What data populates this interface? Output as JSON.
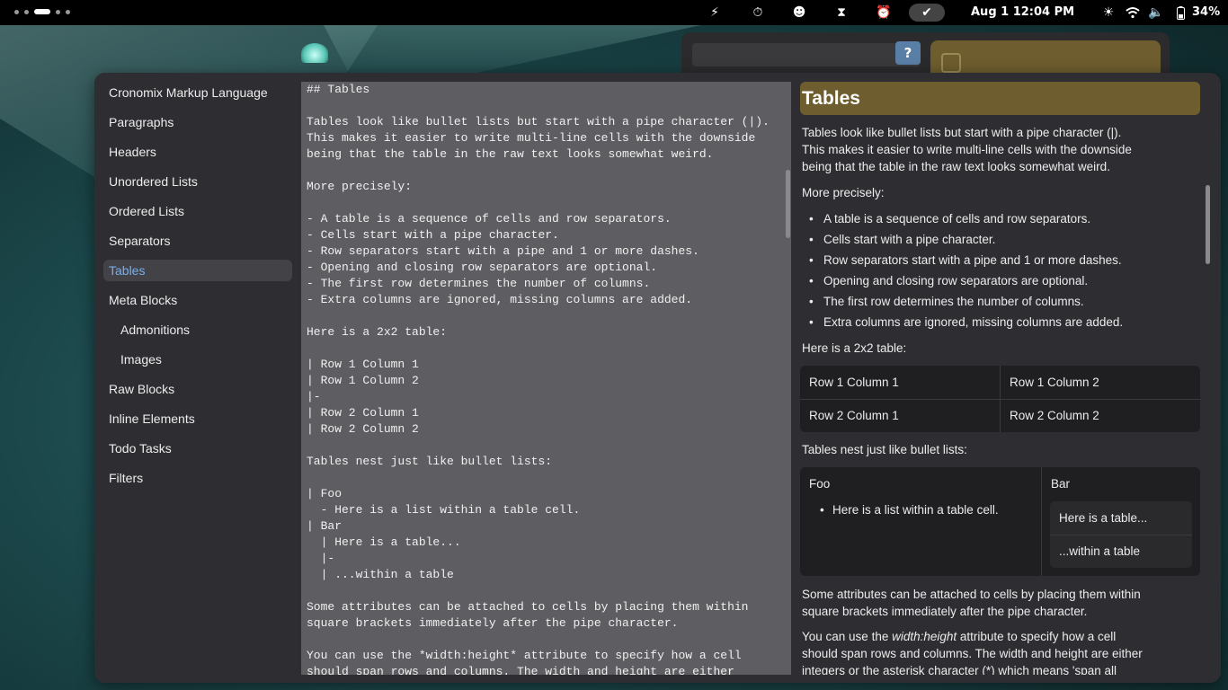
{
  "topbar": {
    "clock": "Aug 1  12:04 PM",
    "battery": "34%",
    "icons": [
      "flash-icon",
      "stopwatch-icon",
      "face-icon",
      "hourglass-icon",
      "alarm-icon",
      "check-icon",
      "brightness-icon",
      "wifi-icon",
      "volume-icon",
      "battery-icon"
    ]
  },
  "background_window": {
    "help_label": "?"
  },
  "sidebar": {
    "items": [
      {
        "label": "Cronomix Markup Language"
      },
      {
        "label": "Paragraphs"
      },
      {
        "label": "Headers"
      },
      {
        "label": "Unordered Lists"
      },
      {
        "label": "Ordered Lists"
      },
      {
        "label": "Separators"
      },
      {
        "label": "Tables"
      },
      {
        "label": "Meta Blocks"
      },
      {
        "label": "Admonitions"
      },
      {
        "label": "Images"
      },
      {
        "label": "Raw Blocks"
      },
      {
        "label": "Inline Elements"
      },
      {
        "label": "Todo Tasks"
      },
      {
        "label": "Filters"
      }
    ],
    "active": "Tables"
  },
  "editor": {
    "text": "## Tables\n\nTables look like bullet lists but start with a pipe character (|).\nThis makes it easier to write multi-line cells with the downside\nbeing that the table in the raw text looks somewhat weird.\n\nMore precisely:\n\n- A table is a sequence of cells and row separators.\n- Cells start with a pipe character.\n- Row separators start with a pipe and 1 or more dashes.\n- Opening and closing row separators are optional.\n- The first row determines the number of columns.\n- Extra columns are ignored, missing columns are added.\n\nHere is a 2x2 table:\n\n| Row 1 Column 1\n| Row 1 Column 2\n|-\n| Row 2 Column 1\n| Row 2 Column 2\n\nTables nest just like bullet lists:\n\n| Foo\n  - Here is a list within a table cell.\n| Bar\n  | Here is a table...\n  |-\n  | ...within a table\n\nSome attributes can be attached to cells by placing them within\nsquare brackets immediately after the pipe character.\n\nYou can use the *width:height* attribute to specify how a cell\nshould span rows and columns. The width and height are either"
  },
  "preview": {
    "title": "Tables",
    "intro": [
      "Tables look like bullet lists but start with a pipe character (|).",
      "This makes it easier to write multi-line cells with the downside",
      "being that the table in the raw text looks somewhat weird."
    ],
    "more_precisely": "More precisely:",
    "bullets": [
      "A table is a sequence of cells and row separators.",
      "Cells start with a pipe character.",
      "Row separators start with a pipe and 1 or more dashes.",
      "Opening and closing row separators are optional.",
      "The first row determines the number of columns.",
      "Extra columns are ignored, missing columns are added."
    ],
    "table_intro": "Here is a 2x2 table:",
    "table": [
      [
        "Row 1 Column 1",
        "Row 1 Column 2"
      ],
      [
        "Row 2 Column 1",
        "Row 2 Column 2"
      ]
    ],
    "nest_intro": "Tables nest just like bullet lists:",
    "nest": {
      "foo": "Foo",
      "foo_item": "Here is a list within a table cell.",
      "bar": "Bar",
      "bar_rows": [
        "Here is a table...",
        "...within a table"
      ]
    },
    "attr_para": [
      "Some attributes can be attached to cells by placing them within",
      "square brackets immediately after the pipe character."
    ],
    "span_para": {
      "prefix": "You can use the ",
      "em": "width:height",
      "suffix": " attribute to specify how a cell",
      "line2": "should span rows and columns. The width and height are either",
      "line3": "integers or the asterisk character (*) which means 'span all"
    }
  }
}
